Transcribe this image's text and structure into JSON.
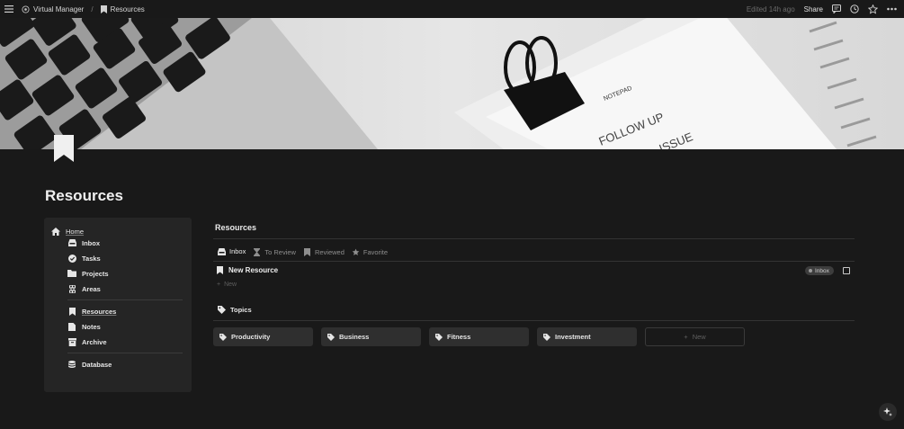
{
  "topbar": {
    "workspace": "Virtual Manager",
    "page": "Resources",
    "edited": "Edited 14h ago",
    "share": "Share"
  },
  "cover": {
    "notepad_text": "NOTEPAD",
    "handwriting_line1": "FOLLOW UP",
    "handwriting_line2": "ISSUE"
  },
  "page": {
    "title": "Resources"
  },
  "nav": {
    "home": "Home",
    "items": [
      "Inbox",
      "Tasks",
      "Projects",
      "Areas"
    ],
    "items2": [
      "Resources",
      "Notes",
      "Archive"
    ],
    "items3": [
      "Database"
    ]
  },
  "main": {
    "section_title": "Resources",
    "tabs": [
      "Inbox",
      "To Review",
      "Reviewed",
      "Favorite"
    ],
    "active_tab": "Inbox",
    "rows": [
      {
        "title": "New Resource",
        "status": "Inbox"
      }
    ],
    "new_label": "New"
  },
  "topics": {
    "title": "Topics",
    "items": [
      "Productivity",
      "Business",
      "Fitness",
      "Investment"
    ],
    "new_label": "New"
  },
  "colors": {
    "background": "#191919",
    "card": "#2f2f2f",
    "nav_card": "#252525"
  }
}
